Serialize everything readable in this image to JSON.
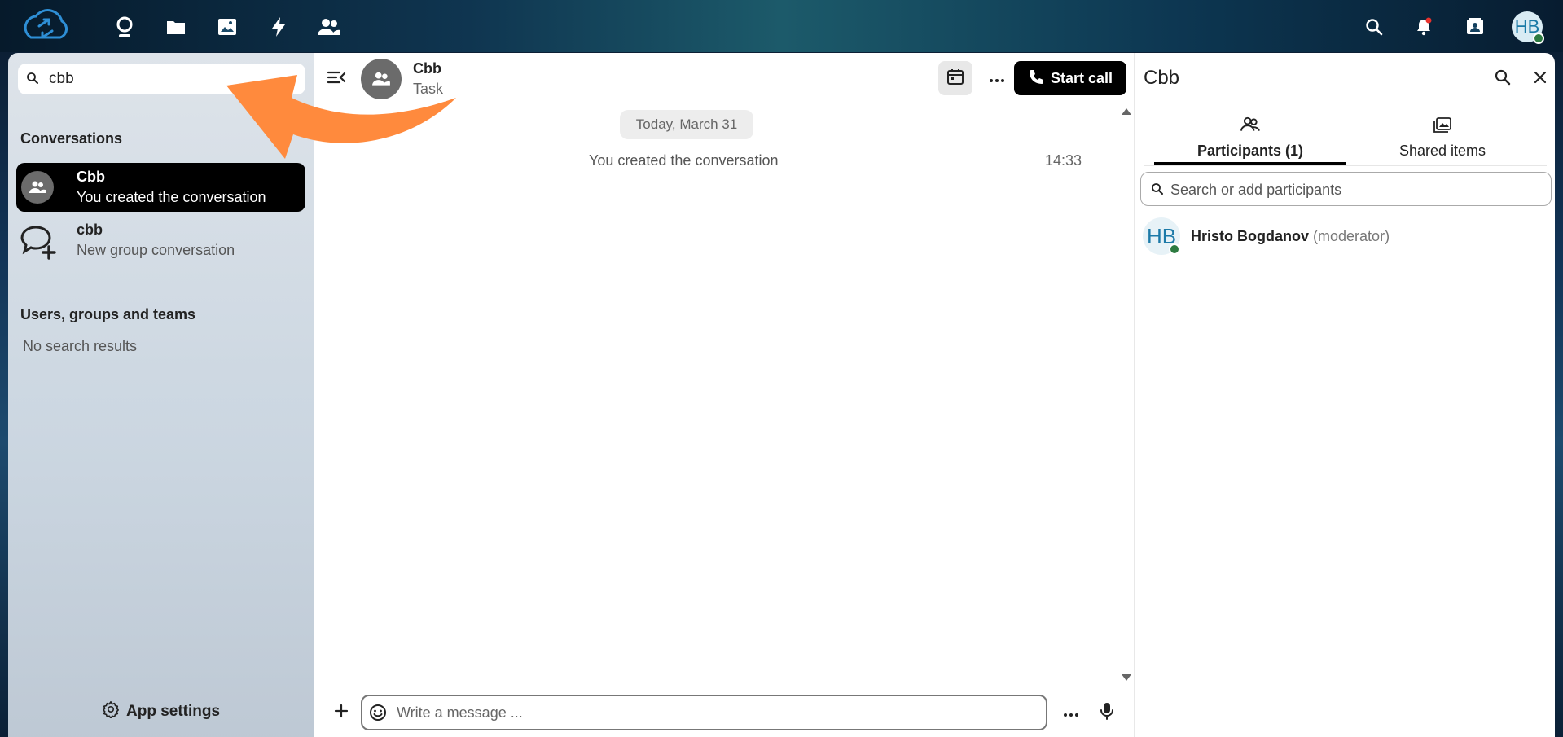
{
  "header": {
    "apps": [
      "dashboard-icon",
      "files-icon",
      "photos-icon",
      "activity-icon",
      "contacts-icon"
    ],
    "avatar_initials": "HB"
  },
  "sidebar": {
    "search_value": "cbb",
    "conversations_title": "Conversations",
    "conversations": [
      {
        "name": "Cbb",
        "subtitle": "You created the conversation",
        "active": true
      },
      {
        "name": "cbb",
        "subtitle": "New group conversation",
        "active": false
      }
    ],
    "users_title": "Users, groups and teams",
    "no_results": "No search results",
    "app_settings": "App settings"
  },
  "chat": {
    "title": "Cbb",
    "subtitle": "Task",
    "start_call": "Start call",
    "date_separator": "Today, March 31",
    "system_message": "You created the conversation",
    "system_time": "14:33",
    "composer_placeholder": "Write a message ..."
  },
  "right_panel": {
    "title": "Cbb",
    "tabs": [
      {
        "label": "Participants (1)",
        "active": true
      },
      {
        "label": "Shared items",
        "active": false
      }
    ],
    "search_placeholder": "Search or add participants",
    "participants": [
      {
        "initials": "HB",
        "name": "Hristo Bogdanov",
        "role": "(moderator)"
      }
    ]
  },
  "colors": {
    "accent": "#000000",
    "status_online": "#2d7b41",
    "annotation_arrow": "#ff8a3d"
  }
}
